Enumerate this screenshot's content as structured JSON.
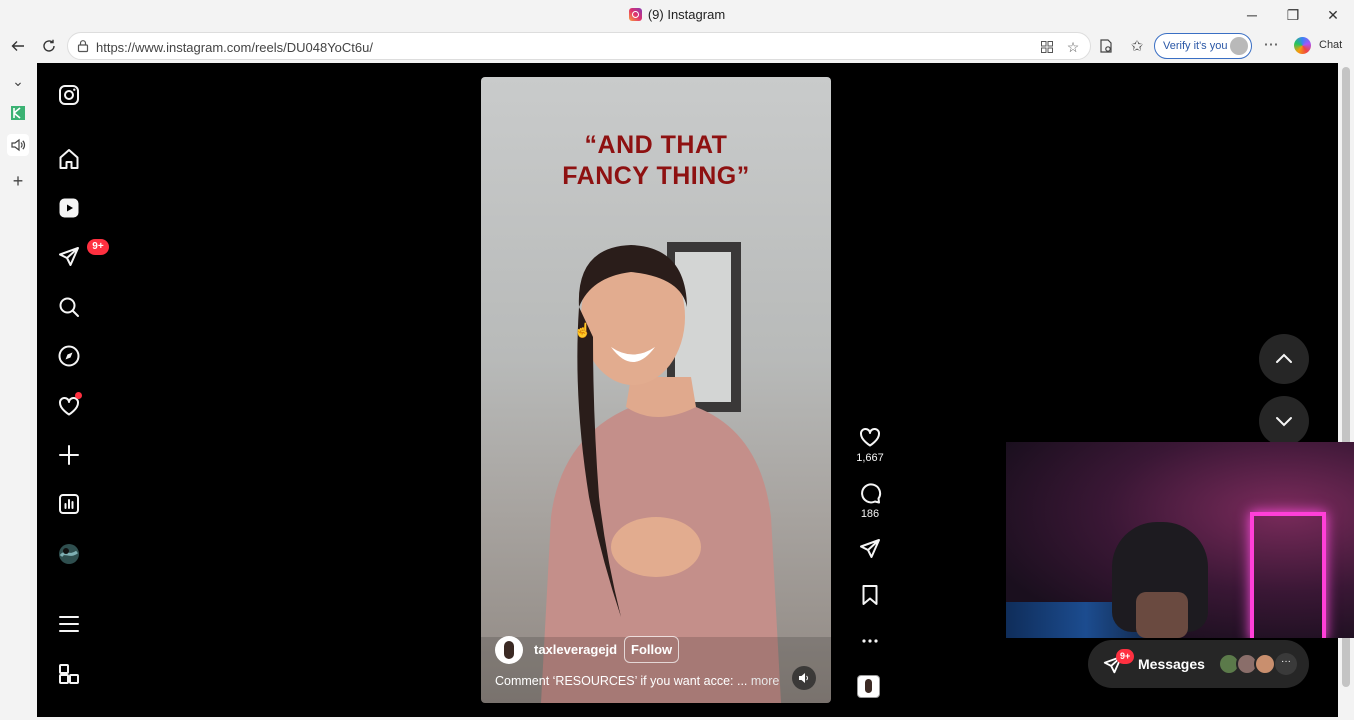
{
  "window": {
    "title": "(9) Instagram",
    "minimize": "─",
    "restore": "❐",
    "close": "✕"
  },
  "toolbar": {
    "url": "https://www.instagram.com/reels/DU048YoCt6u/",
    "verify_label": "Verify it's you",
    "chat_label": "Chat"
  },
  "instagram": {
    "nav_badge_messages": "9+",
    "reel": {
      "caption_line1": "“AND THAT",
      "caption_line2": "FANCY THING”",
      "username": "taxleveragejd",
      "follow_label": "Follow",
      "description": "Comment ‘RESOURCES’ if you want acce: ...",
      "more_label": "more"
    },
    "actions": {
      "likes": "1,667",
      "comments": "186"
    },
    "messages": {
      "label": "Messages",
      "badge": "9+",
      "more": "···"
    }
  }
}
